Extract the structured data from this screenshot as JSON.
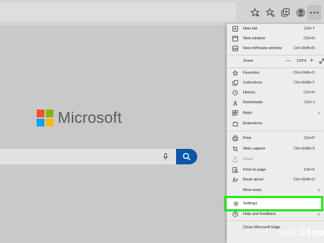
{
  "browser": {
    "toolbar_icons": [
      "add-to-favorites-icon",
      "favorites-icon",
      "collections-icon",
      "profile-icon",
      "more-options-icon"
    ]
  },
  "newtab": {
    "logo_text": "Microsoft",
    "logo_colors": [
      "#f25022",
      "#7fba00",
      "#00a4ef",
      "#ffb900"
    ],
    "search_button_color": "#0b56a8"
  },
  "menu": {
    "new_tab": {
      "label": "New tab",
      "shortcut": "Ctrl+T"
    },
    "new_window": {
      "label": "New window",
      "shortcut": "Ctrl+N"
    },
    "new_inprivate": {
      "label": "New InPrivate window",
      "shortcut": "Ctrl+Shift+N"
    },
    "zoom": {
      "label": "Zoom",
      "minus": "—",
      "value": "100%",
      "plus": "+"
    },
    "favorites": {
      "label": "Favorites",
      "shortcut": "Ctrl+Shift+O"
    },
    "collections": {
      "label": "Collections",
      "shortcut": "Ctrl+Shift+Y"
    },
    "history": {
      "label": "History",
      "shortcut": "Ctrl+H"
    },
    "downloads": {
      "label": "Downloads",
      "shortcut": "Ctrl+J"
    },
    "apps": {
      "label": "Apps"
    },
    "extensions": {
      "label": "Extensions"
    },
    "print": {
      "label": "Print",
      "shortcut": "Ctrl+P"
    },
    "web_capture": {
      "label": "Web capture",
      "shortcut": "Ctrl+Shift+S"
    },
    "share": {
      "label": "Share"
    },
    "find_on_page": {
      "label": "Find on page",
      "shortcut": "Ctrl+F"
    },
    "read_aloud": {
      "label": "Read aloud",
      "shortcut": "Ctrl+Shift+U"
    },
    "more_tools": {
      "label": "More tools"
    },
    "settings": {
      "label": "Settings"
    },
    "help": {
      "label": "Help and feedback"
    },
    "close": {
      "label": "Close Microsoft Edge"
    }
  },
  "highlight_color": "#22e81e",
  "watermark": {
    "wiki": "wiki",
    "how": "How"
  }
}
